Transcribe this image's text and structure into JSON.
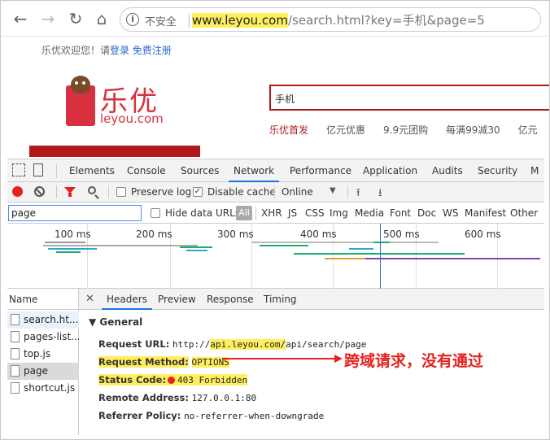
{
  "browser": {
    "security_label": "不安全",
    "url_host": "www.leyou.com",
    "url_rest": "/search.html?key=手机&page=5"
  },
  "site": {
    "welcome": "乐优欢迎您！请",
    "login": "登录",
    "register": "免费注册",
    "logo_cn": "乐优",
    "logo_en": "leyou.com",
    "search_value": "手机",
    "hotlinks": [
      "乐优首发",
      "亿元优惠",
      "9.9元团购",
      "每满99减30",
      "亿元"
    ]
  },
  "devtools": {
    "tabs": [
      "Elements",
      "Console",
      "Sources",
      "Network",
      "Performance",
      "Application",
      "Audits",
      "Security",
      "M"
    ],
    "active_tab": "Network",
    "toolbar": {
      "preserve_log": "Preserve log",
      "disable_cache": "Disable cache",
      "throttle": "Online"
    },
    "filter": {
      "value": "page",
      "hide_data_urls": "Hide data URLs",
      "all": "All",
      "types": [
        "XHR",
        "JS",
        "CSS",
        "Img",
        "Media",
        "Font",
        "Doc",
        "WS",
        "Manifest",
        "Other"
      ]
    },
    "timeline_ticks": [
      "100 ms",
      "200 ms",
      "300 ms",
      "400 ms",
      "500 ms",
      "600 ms"
    ],
    "name_header": "Name",
    "files": [
      "search.ht...",
      "pages-list...",
      "top.js",
      "page",
      "shortcut.js"
    ],
    "detail_tabs": [
      "Headers",
      "Preview",
      "Response",
      "Timing"
    ],
    "general_label": "▼ General",
    "general": {
      "request_url_key": "Request URL:",
      "request_url_prefix": "http://",
      "request_url_host": "api.leyou.com/",
      "request_url_rest": "api/search/page",
      "method_key": "Request Method:",
      "method_val": "OPTIONS",
      "status_key": "Status Code:",
      "status_val": "403 Forbidden",
      "remote_key": "Remote Address:",
      "remote_val": "127.0.0.1:80",
      "referrer_key": "Referrer Policy:",
      "referrer_val": "no-referrer-when-downgrade"
    }
  },
  "annotation": "跨域请求，没有通过"
}
